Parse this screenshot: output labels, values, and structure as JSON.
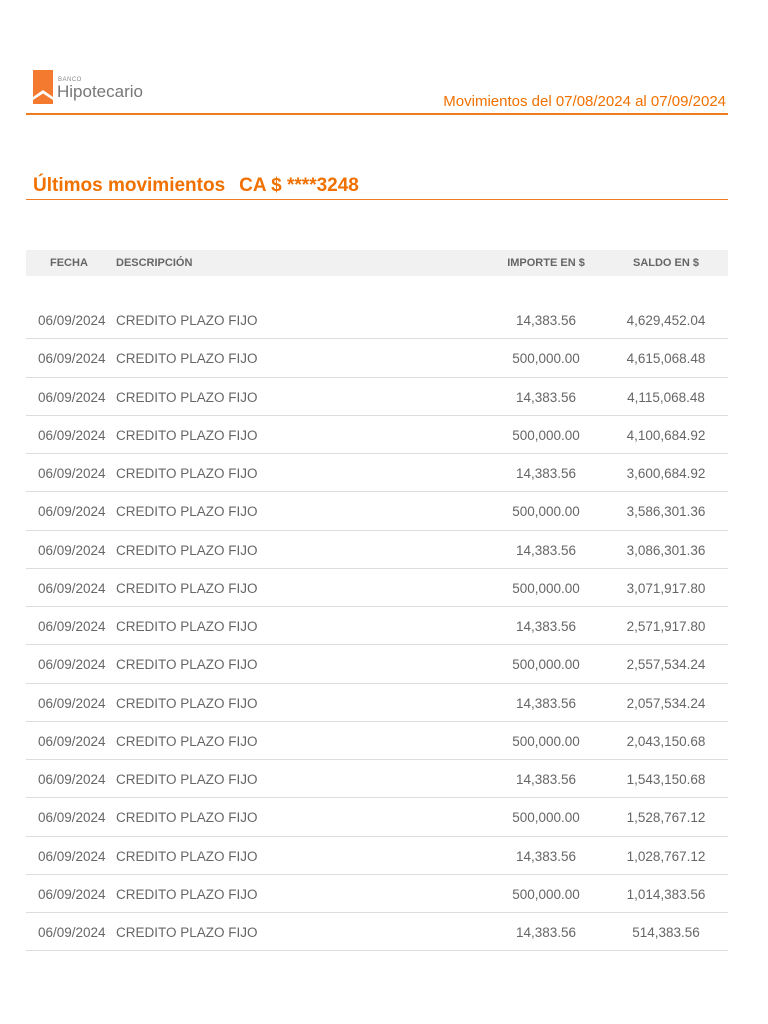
{
  "header": {
    "bank_small": "BANCO",
    "bank_name": "Hipotecario",
    "period": "Movimientos del 07/08/2024 al 07/09/2024",
    "accent_color": "#f07000"
  },
  "section": {
    "title": "Últimos movimientos",
    "account": "CA $ ****3248"
  },
  "table": {
    "columns": [
      "FECHA",
      "DESCRIPCIÓN",
      "IMPORTE EN $",
      "SALDO EN $"
    ],
    "rows": [
      [
        "06/09/2024",
        "CREDITO PLAZO FIJO",
        "14,383.56",
        "4,629,452.04"
      ],
      [
        "06/09/2024",
        "CREDITO PLAZO FIJO",
        "500,000.00",
        "4,615,068.48"
      ],
      [
        "06/09/2024",
        "CREDITO PLAZO FIJO",
        "14,383.56",
        "4,115,068.48"
      ],
      [
        "06/09/2024",
        "CREDITO PLAZO FIJO",
        "500,000.00",
        "4,100,684.92"
      ],
      [
        "06/09/2024",
        "CREDITO PLAZO FIJO",
        "14,383.56",
        "3,600,684.92"
      ],
      [
        "06/09/2024",
        "CREDITO PLAZO FIJO",
        "500,000.00",
        "3,586,301.36"
      ],
      [
        "06/09/2024",
        "CREDITO PLAZO FIJO",
        "14,383.56",
        "3,086,301.36"
      ],
      [
        "06/09/2024",
        "CREDITO PLAZO FIJO",
        "500,000.00",
        "3,071,917.80"
      ],
      [
        "06/09/2024",
        "CREDITO PLAZO FIJO",
        "14,383.56",
        "2,571,917.80"
      ],
      [
        "06/09/2024",
        "CREDITO PLAZO FIJO",
        "500,000.00",
        "2,557,534.24"
      ],
      [
        "06/09/2024",
        "CREDITO PLAZO FIJO",
        "14,383.56",
        "2,057,534.24"
      ],
      [
        "06/09/2024",
        "CREDITO PLAZO FIJO",
        "500,000.00",
        "2,043,150.68"
      ],
      [
        "06/09/2024",
        "CREDITO PLAZO FIJO",
        "14,383.56",
        "1,543,150.68"
      ],
      [
        "06/09/2024",
        "CREDITO PLAZO FIJO",
        "500,000.00",
        "1,528,767.12"
      ],
      [
        "06/09/2024",
        "CREDITO PLAZO FIJO",
        "14,383.56",
        "1,028,767.12"
      ],
      [
        "06/09/2024",
        "CREDITO PLAZO FIJO",
        "500,000.00",
        "1,014,383.56"
      ],
      [
        "06/09/2024",
        "CREDITO PLAZO FIJO",
        "14,383.56",
        "514,383.56"
      ]
    ]
  }
}
